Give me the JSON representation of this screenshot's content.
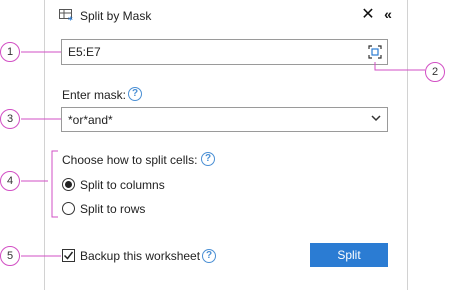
{
  "panel": {
    "title": "Split by Mask",
    "close_icon": "close-icon",
    "collapse_icon": "collapse-icon"
  },
  "range": {
    "value": "E5:E7",
    "picker_icon": "select-range-icon"
  },
  "mask": {
    "label": "Enter mask:",
    "value": "*or*and*",
    "help_icon": "help-icon"
  },
  "split": {
    "label": "Choose how to split cells:",
    "options": [
      {
        "label": "Split to columns",
        "selected": true
      },
      {
        "label": "Split to rows",
        "selected": false
      }
    ]
  },
  "backup": {
    "label": "Backup this worksheet",
    "checked": true
  },
  "button": {
    "split_label": "Split"
  },
  "callouts": [
    "1",
    "2",
    "3",
    "4",
    "5"
  ],
  "colors": {
    "accent": "#2b7cd3",
    "callout": "#d24fc4",
    "help": "#4a8fd4"
  }
}
